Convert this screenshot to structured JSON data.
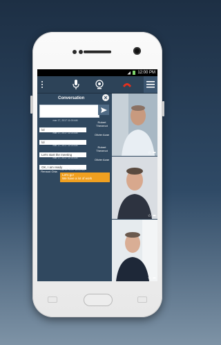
{
  "status_bar": {
    "time": "12:00 PM"
  },
  "toolbar": {
    "icons": [
      "more-vert-icon",
      "microphone-icon",
      "camera-icon",
      "hang-up-icon",
      "hamburger-menu-icon"
    ],
    "hangup_color": "#e0311f"
  },
  "conversation": {
    "title": "Conversation",
    "compose_placeholder": "",
    "messages": [
      {
        "meta": "mar 17, 2017 11:00 AM",
        "text": "lol",
        "sender": "Robert Thevenot"
      },
      {
        "meta": "mar 17, 2017 11:00 AM",
        "text": "lol",
        "sender": "Olivier Azan"
      },
      {
        "meta": "mar 17, 2017 11:00 AM",
        "text": "Let's start the meeting",
        "sender": "Robert Thevenot"
      },
      {
        "meta": "mar 17, 2017 11:00 AM",
        "text": "OK, I am ready",
        "sender": "Olivier Azan"
      },
      {
        "meta": "mar 17, 2017 11:00 AM",
        "text": "Let's go!\nWe have a lot of work",
        "sender": "Renaud Ghia",
        "outgoing": true
      }
    ]
  },
  "colors": {
    "app_background": "#30485f",
    "outgoing_bubble": "#f0a020"
  }
}
